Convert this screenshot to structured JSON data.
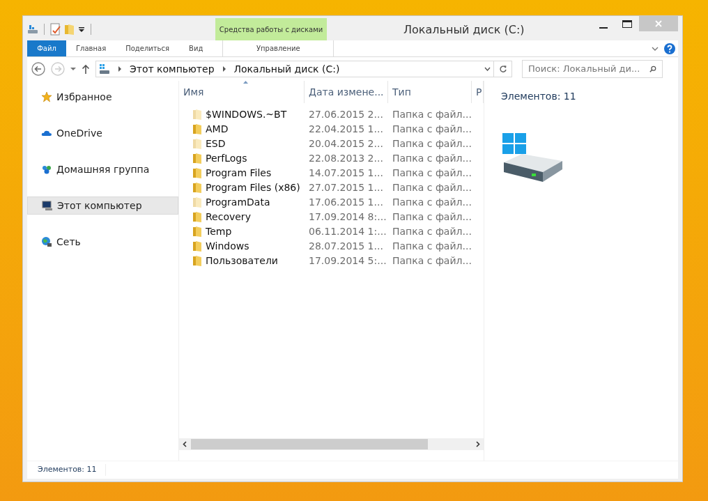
{
  "window": {
    "title": "Локальный диск (C:)"
  },
  "context_tab_group": {
    "label": "Средства работы с дисками"
  },
  "ribbon_tabs": [
    {
      "label": "Файл",
      "kind": "file",
      "selected": false
    },
    {
      "label": "Главная",
      "kind": "normal",
      "selected": false
    },
    {
      "label": "Поделиться",
      "kind": "normal",
      "selected": false
    },
    {
      "label": "Вид",
      "kind": "normal",
      "selected": false
    },
    {
      "label": "Управление",
      "kind": "context",
      "selected": false
    }
  ],
  "address": {
    "breadcrumbs": [
      "Этот компьютер",
      "Локальный диск (C:)"
    ]
  },
  "search": {
    "placeholder": "Поиск: Локальный ди..."
  },
  "navigation": [
    {
      "label": "Избранное",
      "kind": "favorites",
      "selected": false
    },
    {
      "label": "OneDrive",
      "kind": "cloud",
      "selected": false
    },
    {
      "label": "Домашняя группа",
      "kind": "homegroup",
      "selected": false
    },
    {
      "label": "Этот компьютер",
      "kind": "computer",
      "selected": true
    },
    {
      "label": "Сеть",
      "kind": "network",
      "selected": false
    }
  ],
  "columns": [
    "Имя",
    "Дата измене...",
    "Тип",
    "Р"
  ],
  "files": [
    {
      "name": "$WINDOWS.~BT",
      "date": "27.06.2015 2...",
      "type": "Папка с файл...",
      "hidden": true
    },
    {
      "name": "AMD",
      "date": "22.04.2015 1...",
      "type": "Папка с файл...",
      "hidden": false
    },
    {
      "name": "ESD",
      "date": "20.04.2015 2...",
      "type": "Папка с файл...",
      "hidden": true
    },
    {
      "name": "PerfLogs",
      "date": "22.08.2013 2...",
      "type": "Папка с файл...",
      "hidden": false
    },
    {
      "name": "Program Files",
      "date": "14.07.2015 1...",
      "type": "Папка с файл...",
      "hidden": false
    },
    {
      "name": "Program Files (x86)",
      "date": "27.07.2015 1...",
      "type": "Папка с файл...",
      "hidden": false
    },
    {
      "name": "ProgramData",
      "date": "17.06.2015 1...",
      "type": "Папка с файл...",
      "hidden": true
    },
    {
      "name": "Recovery",
      "date": "17.09.2014 8:...",
      "type": "Папка с файл...",
      "hidden": false
    },
    {
      "name": "Temp",
      "date": "06.11.2014 1:...",
      "type": "Папка с файл...",
      "hidden": false
    },
    {
      "name": "Windows",
      "date": "28.07.2015 1...",
      "type": "Папка с файл...",
      "hidden": false
    },
    {
      "name": "Пользователи",
      "date": "17.09.2014 5:...",
      "type": "Папка с файл...",
      "hidden": false
    }
  ],
  "details": {
    "count": "Элементов: 11"
  },
  "status_bar": {
    "count": "Элементов: 11"
  }
}
